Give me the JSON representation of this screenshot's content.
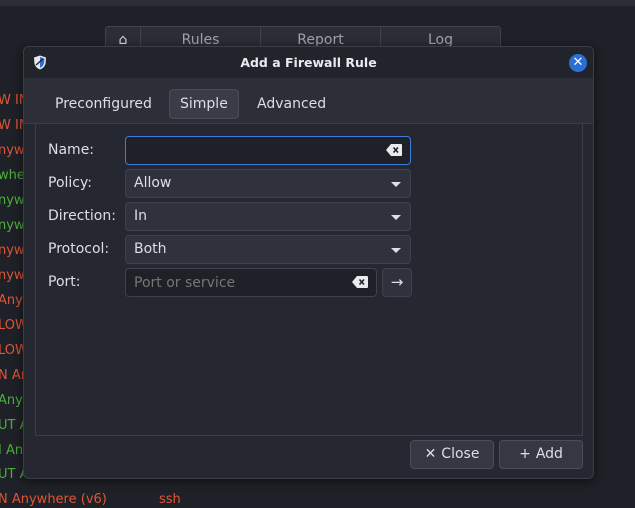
{
  "background": {
    "tabs": [
      {
        "label": "Rules"
      },
      {
        "label": "Report"
      },
      {
        "label": "Log"
      }
    ],
    "rule_fragments": [
      {
        "text": "W IN",
        "color": "r"
      },
      {
        "text": "W IN",
        "color": "r"
      },
      {
        "text": "nywh",
        "color": "r"
      },
      {
        "text": "whe",
        "color": "g"
      },
      {
        "text": "nywh",
        "color": "g"
      },
      {
        "text": "nywh",
        "color": "g"
      },
      {
        "text": "nywh",
        "color": "r"
      },
      {
        "text": "nywh",
        "color": "r"
      },
      {
        "text": "Any",
        "color": "r"
      },
      {
        "text": "LOW",
        "color": "r"
      },
      {
        "text": "LOW",
        "color": "r"
      },
      {
        "text": "N An",
        "color": "r"
      },
      {
        "text": "Any",
        "color": "g"
      },
      {
        "text": "UT A",
        "color": "g"
      },
      {
        "text": "I An",
        "color": "g"
      },
      {
        "text": "UT A",
        "color": "g"
      }
    ],
    "last_rule": "N Anywhere (v6)",
    "last_rule_service": "ssh"
  },
  "dialog": {
    "title": "Add a Firewall Rule",
    "tabs": {
      "preconfigured": "Preconfigured",
      "simple": "Simple",
      "advanced": "Advanced"
    },
    "form": {
      "name_label": "Name:",
      "name_value": "",
      "policy_label": "Policy:",
      "policy_value": "Allow",
      "direction_label": "Direction:",
      "direction_value": "In",
      "protocol_label": "Protocol:",
      "protocol_value": "Both",
      "port_label": "Port:",
      "port_placeholder": "Port or service"
    },
    "buttons": {
      "close": "Close",
      "add": "Add"
    }
  },
  "colors": {
    "accent": "#3d7be0",
    "deny": "#e05535",
    "allow": "#4caf3d"
  }
}
